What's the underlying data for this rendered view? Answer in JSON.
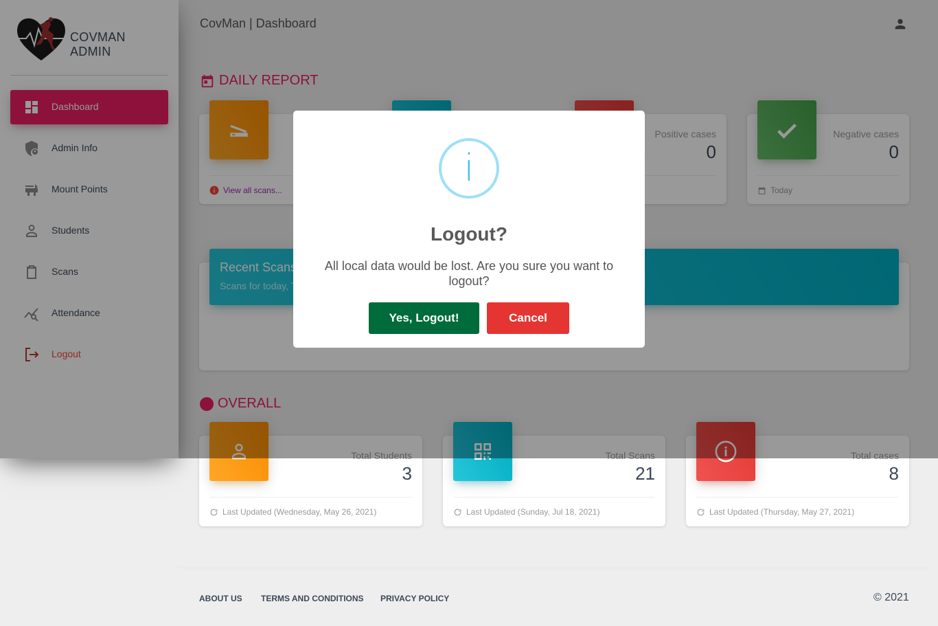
{
  "brand": {
    "name": "COVMAN ADMIN"
  },
  "sidebar": {
    "items": [
      {
        "label": "Dashboard",
        "icon": "dashboard-icon",
        "active": true
      },
      {
        "label": "Admin Info",
        "icon": "shield-user-icon"
      },
      {
        "label": "Mount Points",
        "icon": "mount-point-icon"
      },
      {
        "label": "Students",
        "icon": "person-icon"
      },
      {
        "label": "Scans",
        "icon": "clipboard-icon"
      },
      {
        "label": "Attendance",
        "icon": "analytics-icon"
      },
      {
        "label": "Logout",
        "icon": "logout-icon"
      }
    ]
  },
  "header": {
    "title": "CovMan | Dashboard"
  },
  "daily": {
    "title": "DAILY REPORT",
    "cards": [
      {
        "category": "",
        "value": "",
        "footer": "View all scans...",
        "color": "#fb8c00"
      },
      {
        "category": "",
        "value": "",
        "footer": "",
        "color": "#00acc1"
      },
      {
        "category": "Positive cases",
        "value": "0",
        "footer": "",
        "color": "#e53935"
      },
      {
        "category": "Negative cases",
        "value": "0",
        "footer": "Today",
        "color": "#43a047"
      }
    ]
  },
  "recent": {
    "title": "Recent Scans",
    "subtitle": "Scans for today, T"
  },
  "overall": {
    "title": "OVERALL",
    "cards": [
      {
        "category": "Total Students",
        "value": "3",
        "footer": "Last Updated (Wednesday, May 26, 2021)"
      },
      {
        "category": "Total Scans",
        "value": "21",
        "footer": "Last Updated (Sunday, Jul 18, 2021)"
      },
      {
        "category": "Total cases",
        "value": "8",
        "footer": "Last Updated (Thursday, May 27, 2021)"
      }
    ]
  },
  "footer": {
    "links": [
      "ABOUT US",
      "TERMS AND CONDITIONS",
      "PRIVACY POLICY"
    ],
    "copyright": "© 2021"
  },
  "modal": {
    "icon": "i",
    "title": "Logout?",
    "text": "All local data would be lost. Are you sure you want to logout?",
    "confirm": "Yes, Logout!",
    "cancel": "Cancel"
  }
}
